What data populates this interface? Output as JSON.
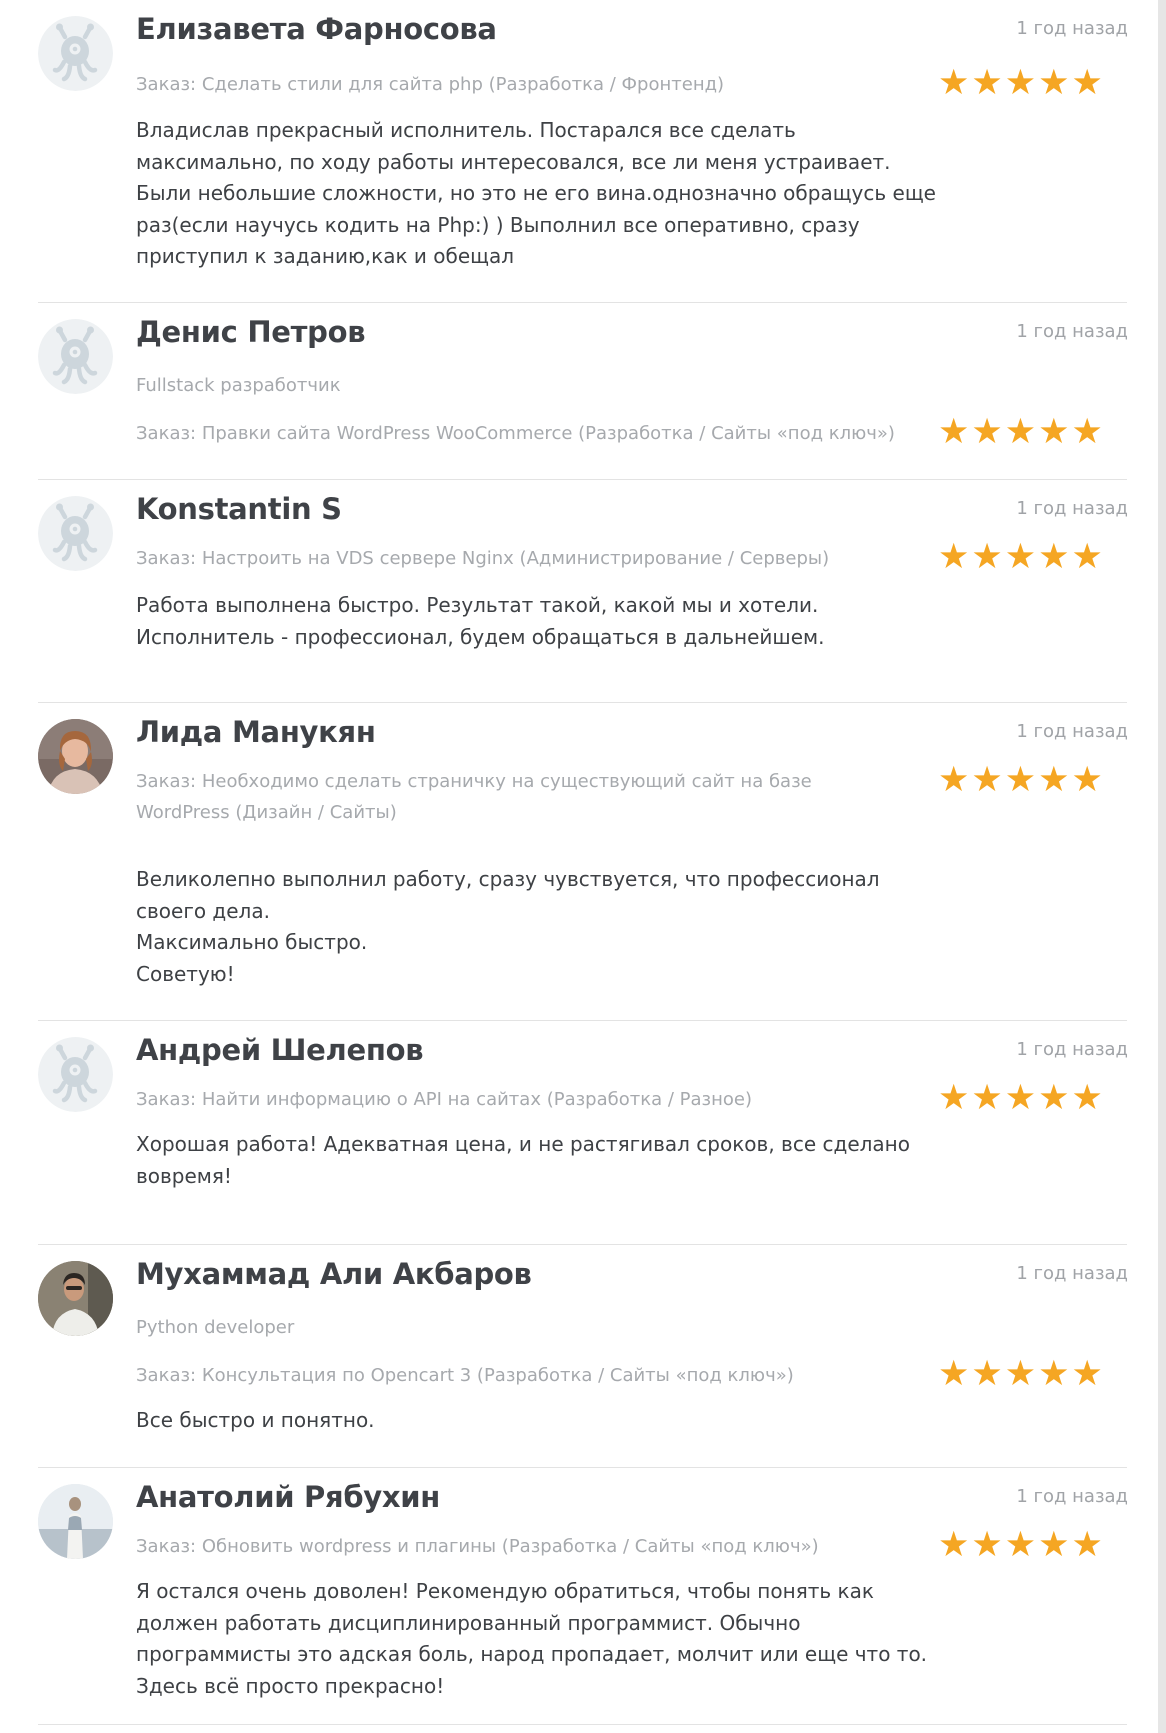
{
  "colors": {
    "star": "#f5a623",
    "name": "#3f4247",
    "meta": "#a6a9ad",
    "body": "#3e4145",
    "divider": "#e3e3e3"
  },
  "reviews": [
    {
      "name": "Елизавета Фарносова",
      "time": "1 год назад",
      "subtitle": "",
      "avatar": "default-logo",
      "rating": 5,
      "rating_display": "★★★★★",
      "order": "Заказ: Сделать стили для сайта php (Разработка / Фронтенд)",
      "text": "Владислав прекрасный исполнитель. Постарался все сделать максимально, по ходу работы интересовался, все ли меня устраивает. Были небольшие сложности, но это не его вина.однозначно обращусь еще раз(если научусь кодить на Php:) ) Выполнил все оперативно, сразу приступил к заданию,как и обещал"
    },
    {
      "name": "Денис Петров",
      "time": "1 год назад",
      "subtitle": "Fullstack разработчик",
      "avatar": "default-logo",
      "rating": 5,
      "rating_display": "★★★★★",
      "order": "Заказ: Правки сайта WordPress WooCommerce (Разработка / Сайты «под ключ»)",
      "text": ""
    },
    {
      "name": "Konstantin S",
      "time": "1 год назад",
      "subtitle": "",
      "avatar": "default-logo",
      "rating": 5,
      "rating_display": "★★★★★",
      "order": "Заказ: Настроить на VDS сервере Nginx (Администрирование / Серверы)",
      "text": "Работа выполнена быстро. Результат такой, какой мы и хотели.\nИсполнитель - профессионал, будем обращаться в дальнейшем."
    },
    {
      "name": "Лида Манукян",
      "time": "1 год назад",
      "subtitle": "",
      "avatar": "photo-woman",
      "rating": 5,
      "rating_display": "★★★★★",
      "order": "Заказ: Необходимо сделать страничку на существующий сайт на базе WordPress (Дизайн / Сайты)",
      "text": "Великолепно выполнил работу, сразу чувствуется, что профессионал своего дела.\nМаксимально быстро.\nСоветую!"
    },
    {
      "name": "Андрей Шелепов",
      "time": "1 год назад",
      "subtitle": "",
      "avatar": "default-logo",
      "rating": 5,
      "rating_display": "★★★★★",
      "order": "Заказ: Найти информацию о API на сайтах (Разработка / Разное)",
      "text": "Хорошая работа! Адекватная цена, и не растягивал сроков, все сделано вовремя!"
    },
    {
      "name": "Мухаммад Али Акбаров",
      "time": "1 год назад",
      "subtitle": "Python developer",
      "avatar": "photo-man",
      "rating": 5,
      "rating_display": "★★★★★",
      "order": "Заказ: Консультация по Opencart 3 (Разработка / Сайты «под ключ»)",
      "text": "Все быстро и понятно."
    },
    {
      "name": "Анатолий Рябухин",
      "time": "1 год назад",
      "subtitle": "",
      "avatar": "photo-person",
      "rating": 5,
      "rating_display": "★★★★★",
      "order": "Заказ: Обновить wordpress и плагины (Разработка / Сайты «под ключ»)",
      "text": "Я остался очень доволен! Рекомендую обратиться, чтобы понять как должен работать дисциплинированный программист. Обычно программисты это адская боль, народ пропадает, молчит или еще что то. Здесь всё просто прекрасно!"
    }
  ]
}
